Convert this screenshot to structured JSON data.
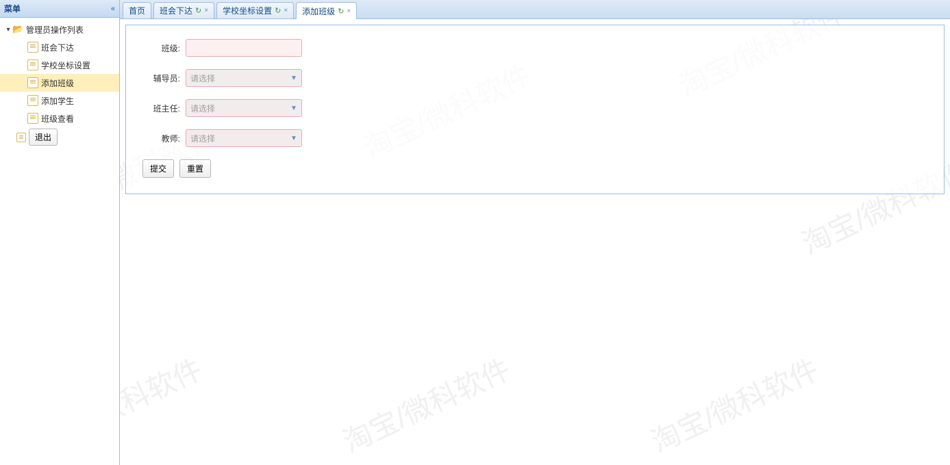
{
  "watermark": "淘宝/微科软件",
  "sidebar": {
    "title": "菜单",
    "nodes": {
      "root": {
        "label": "管理员操作列表"
      },
      "items": [
        {
          "label": "班会下达"
        },
        {
          "label": "学校坐标设置"
        },
        {
          "label": "添加班级"
        },
        {
          "label": "添加学生"
        },
        {
          "label": "班级查看"
        }
      ]
    },
    "logout": "退出"
  },
  "tabs": [
    {
      "label": "首页",
      "closable": false,
      "refresh": false
    },
    {
      "label": "班会下达",
      "closable": true,
      "refresh": true
    },
    {
      "label": "学校坐标设置",
      "closable": true,
      "refresh": true
    },
    {
      "label": "添加班级",
      "closable": true,
      "refresh": true,
      "active": true
    }
  ],
  "form": {
    "class_label": "班级:",
    "counselor_label": "辅导员:",
    "headteacher_label": "班主任:",
    "teacher_label": "教师:",
    "placeholder": "请选择",
    "submit": "提交",
    "reset": "重置"
  }
}
